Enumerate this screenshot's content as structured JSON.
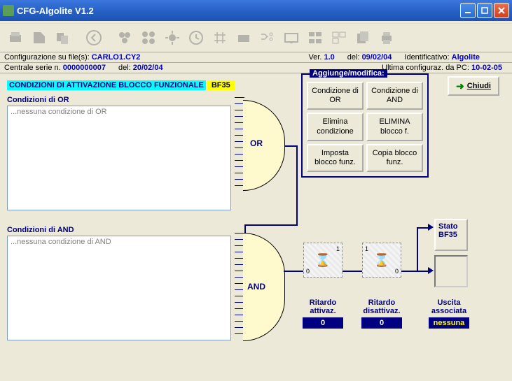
{
  "window": {
    "title": "CFG-Algolite V1.2"
  },
  "info1": {
    "cfg_label": "Configurazione su file(s): ",
    "cfg_value": "CARLO1.CY2",
    "ver_label": "Ver. ",
    "ver_value": "1.0",
    "del_label": "del: ",
    "del_value": "09/02/04",
    "id_label": "Identificativo: ",
    "id_value": "Algolite"
  },
  "info2": {
    "serial_label": "Centrale serie n. ",
    "serial_value": "0000000007",
    "del_label": "del: ",
    "del_value": "20/02/04",
    "last_label": "Ultima configuraz. da PC: ",
    "last_value": "10-02-05"
  },
  "section": {
    "title": "CONDIZIONI DI ATTIVAZIONE BLOCCO FUNZIONALE",
    "bf": "BF35"
  },
  "or": {
    "label": "Condizioni di OR",
    "placeholder": "...nessuna condizione di OR",
    "gate": "OR"
  },
  "and": {
    "label": "Condizioni di AND",
    "placeholder": "...nessuna condizione di AND",
    "gate": "AND"
  },
  "btns": {
    "group_title": "Aggiunge/modifica:",
    "cond_or": "Condizione di  OR",
    "cond_and": "Condizione di  AND",
    "elim_cond": "Elimina condizione",
    "elim_blocco": "ELIMINA blocco f.",
    "imposta": "Imposta blocco funz.",
    "copia": "Copia blocco funz."
  },
  "close_btn": "Chiudi",
  "delays": {
    "attivaz_label": "Ritardo attivaz.",
    "attivaz_value": "0",
    "disattivaz_label": "Ritardo disattivaz.",
    "disattivaz_value": "0",
    "uscita_label": "Uscita associata",
    "uscita_value": "nessuna",
    "stato_label": "Stato",
    "stato_bf": "BF35",
    "one": "1",
    "zero": "0"
  }
}
